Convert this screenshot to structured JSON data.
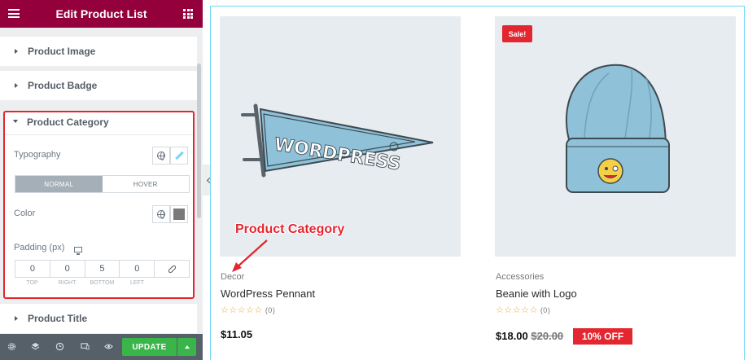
{
  "panel": {
    "title": "Edit Product List",
    "sections": {
      "product_image": "Product Image",
      "product_badge": "Product Badge",
      "product_category": "Product Category",
      "product_title": "Product Title"
    },
    "typography_label": "Typography",
    "state_tabs": {
      "normal": "NORMAL",
      "hover": "HOVER"
    },
    "color_label": "Color",
    "color_value": "#7a7a7a",
    "padding_label": "Padding (px)",
    "padding_values": {
      "top": "0",
      "right": "0",
      "bottom": "5",
      "left": "0"
    },
    "padding_dim_labels": {
      "top": "TOP",
      "right": "RIGHT",
      "bottom": "BOTTOM",
      "left": "LEFT"
    },
    "update_label": "UPDATE"
  },
  "products": [
    {
      "category": "Decor",
      "title": "WordPress Pennant",
      "stars": "☆☆☆☆☆",
      "rating_count": "(0)",
      "price": "$11.05",
      "image": "wordpress-pennant-illustration"
    },
    {
      "category": "Accessories",
      "title": "Beanie with Logo",
      "stars": "☆☆☆☆☆",
      "rating_count": "(0)",
      "price": "$18.00",
      "old_price": "$20.00",
      "discount": "10% OFF",
      "badge": "Sale!",
      "image": "beanie-illustration"
    }
  ],
  "annotation": {
    "text": "Product Category"
  },
  "colors": {
    "brand": "#93003c",
    "accent_red": "#e3262f",
    "update_green": "#39b54a",
    "preview_border": "#71d7f7"
  }
}
